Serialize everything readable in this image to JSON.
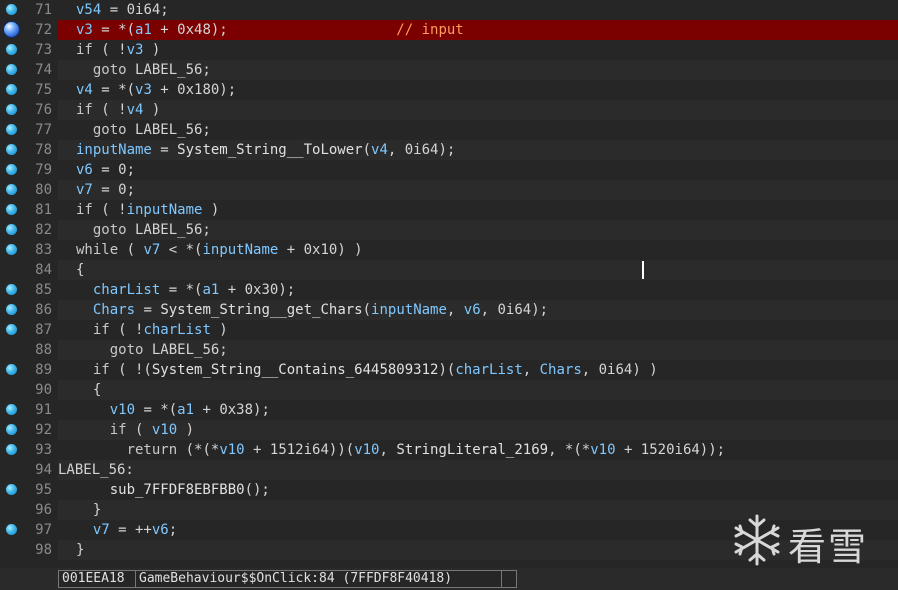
{
  "lines": [
    {
      "ln": "71",
      "bp": "dot",
      "tokens": [
        {
          "t": "v",
          "s": "v54"
        },
        {
          "t": "n",
          "s": " = 0i64;"
        }
      ]
    },
    {
      "ln": "72",
      "bp": "current",
      "hl": true,
      "tokens": [
        {
          "t": "v",
          "s": "v3"
        },
        {
          "t": "n",
          "s": " = *("
        },
        {
          "t": "v",
          "s": "a1"
        },
        {
          "t": "n",
          "s": " + 0x48);"
        },
        {
          "t": "c",
          "s": "                    // input"
        }
      ]
    },
    {
      "ln": "73",
      "bp": "dot",
      "tokens": [
        {
          "t": "k",
          "s": "if"
        },
        {
          "t": "n",
          "s": " ( !"
        },
        {
          "t": "v",
          "s": "v3"
        },
        {
          "t": "n",
          "s": " )"
        }
      ]
    },
    {
      "ln": "74",
      "bp": "dot",
      "tokens": [
        {
          "t": "n",
          "s": "  "
        },
        {
          "t": "k",
          "s": "goto"
        },
        {
          "t": "n",
          "s": " LABEL_56;"
        }
      ]
    },
    {
      "ln": "75",
      "bp": "dot",
      "tokens": [
        {
          "t": "v",
          "s": "v4"
        },
        {
          "t": "n",
          "s": " = *("
        },
        {
          "t": "v",
          "s": "v3"
        },
        {
          "t": "n",
          "s": " + 0x180);"
        }
      ]
    },
    {
      "ln": "76",
      "bp": "dot",
      "tokens": [
        {
          "t": "k",
          "s": "if"
        },
        {
          "t": "n",
          "s": " ( !"
        },
        {
          "t": "v",
          "s": "v4"
        },
        {
          "t": "n",
          "s": " )"
        }
      ]
    },
    {
      "ln": "77",
      "bp": "dot",
      "tokens": [
        {
          "t": "n",
          "s": "  "
        },
        {
          "t": "k",
          "s": "goto"
        },
        {
          "t": "n",
          "s": " LABEL_56;"
        }
      ]
    },
    {
      "ln": "78",
      "bp": "dot",
      "tokens": [
        {
          "t": "v",
          "s": "inputName"
        },
        {
          "t": "n",
          "s": " = "
        },
        {
          "t": "f",
          "s": "System_String__ToLower"
        },
        {
          "t": "n",
          "s": "("
        },
        {
          "t": "v",
          "s": "v4"
        },
        {
          "t": "n",
          "s": ", 0i64);"
        }
      ]
    },
    {
      "ln": "79",
      "bp": "dot",
      "tokens": [
        {
          "t": "v",
          "s": "v6"
        },
        {
          "t": "n",
          "s": " = 0;"
        }
      ]
    },
    {
      "ln": "80",
      "bp": "dot",
      "tokens": [
        {
          "t": "v",
          "s": "v7"
        },
        {
          "t": "n",
          "s": " = 0;"
        }
      ]
    },
    {
      "ln": "81",
      "bp": "dot",
      "tokens": [
        {
          "t": "k",
          "s": "if"
        },
        {
          "t": "n",
          "s": " ( !"
        },
        {
          "t": "v",
          "s": "inputName"
        },
        {
          "t": "n",
          "s": " )"
        }
      ]
    },
    {
      "ln": "82",
      "bp": "dot",
      "tokens": [
        {
          "t": "n",
          "s": "  "
        },
        {
          "t": "k",
          "s": "goto"
        },
        {
          "t": "n",
          "s": " LABEL_56;"
        }
      ]
    },
    {
      "ln": "83",
      "bp": "dot",
      "tokens": [
        {
          "t": "k",
          "s": "while"
        },
        {
          "t": "n",
          "s": " ( "
        },
        {
          "t": "v",
          "s": "v7"
        },
        {
          "t": "n",
          "s": " < *("
        },
        {
          "t": "v",
          "s": "inputName"
        },
        {
          "t": "n",
          "s": " + 0x10) )"
        }
      ]
    },
    {
      "ln": "84",
      "bp": "none",
      "tokens": [
        {
          "t": "n",
          "s": "{"
        }
      ]
    },
    {
      "ln": "85",
      "bp": "dot",
      "tokens": [
        {
          "t": "n",
          "s": "  "
        },
        {
          "t": "v",
          "s": "charList"
        },
        {
          "t": "n",
          "s": " = *("
        },
        {
          "t": "v",
          "s": "a1"
        },
        {
          "t": "n",
          "s": " + 0x30);"
        }
      ]
    },
    {
      "ln": "86",
      "bp": "dot",
      "tokens": [
        {
          "t": "n",
          "s": "  "
        },
        {
          "t": "v",
          "s": "Chars"
        },
        {
          "t": "n",
          "s": " = "
        },
        {
          "t": "f",
          "s": "System_String__get_Chars"
        },
        {
          "t": "n",
          "s": "("
        },
        {
          "t": "v",
          "s": "inputName"
        },
        {
          "t": "n",
          "s": ", "
        },
        {
          "t": "v",
          "s": "v6"
        },
        {
          "t": "n",
          "s": ", 0i64);"
        }
      ]
    },
    {
      "ln": "87",
      "bp": "dot",
      "tokens": [
        {
          "t": "n",
          "s": "  "
        },
        {
          "t": "k",
          "s": "if"
        },
        {
          "t": "n",
          "s": " ( !"
        },
        {
          "t": "v",
          "s": "charList"
        },
        {
          "t": "n",
          "s": " )"
        }
      ]
    },
    {
      "ln": "88",
      "bp": "none",
      "tokens": [
        {
          "t": "n",
          "s": "    "
        },
        {
          "t": "k",
          "s": "goto"
        },
        {
          "t": "n",
          "s": " LABEL_56;"
        }
      ]
    },
    {
      "ln": "89",
      "bp": "dot",
      "tokens": [
        {
          "t": "n",
          "s": "  "
        },
        {
          "t": "k",
          "s": "if"
        },
        {
          "t": "n",
          "s": " ( !("
        },
        {
          "t": "f",
          "s": "System_String__Contains_6445809312"
        },
        {
          "t": "n",
          "s": ")("
        },
        {
          "t": "v",
          "s": "charList"
        },
        {
          "t": "n",
          "s": ", "
        },
        {
          "t": "v",
          "s": "Chars"
        },
        {
          "t": "n",
          "s": ", 0i64) )"
        }
      ]
    },
    {
      "ln": "90",
      "bp": "none",
      "tokens": [
        {
          "t": "n",
          "s": "  {"
        }
      ]
    },
    {
      "ln": "91",
      "bp": "dot",
      "tokens": [
        {
          "t": "n",
          "s": "    "
        },
        {
          "t": "v",
          "s": "v10"
        },
        {
          "t": "n",
          "s": " = *("
        },
        {
          "t": "v",
          "s": "a1"
        },
        {
          "t": "n",
          "s": " + 0x38);"
        }
      ]
    },
    {
      "ln": "92",
      "bp": "dot",
      "tokens": [
        {
          "t": "n",
          "s": "    "
        },
        {
          "t": "k",
          "s": "if"
        },
        {
          "t": "n",
          "s": " ( "
        },
        {
          "t": "v",
          "s": "v10"
        },
        {
          "t": "n",
          "s": " )"
        }
      ]
    },
    {
      "ln": "93",
      "bp": "dot",
      "tokens": [
        {
          "t": "n",
          "s": "      "
        },
        {
          "t": "k",
          "s": "return"
        },
        {
          "t": "n",
          "s": " (*(*"
        },
        {
          "t": "v",
          "s": "v10"
        },
        {
          "t": "n",
          "s": " + 1512i64))("
        },
        {
          "t": "v",
          "s": "v10"
        },
        {
          "t": "n",
          "s": ", "
        },
        {
          "t": "f",
          "s": "StringLiteral_2169"
        },
        {
          "t": "n",
          "s": ", *(*"
        },
        {
          "t": "v",
          "s": "v10"
        },
        {
          "t": "n",
          "s": " + 1520i64));"
        }
      ]
    },
    {
      "ln": "94",
      "bp": "none",
      "label": true,
      "tokens": [
        {
          "t": "n",
          "s": "LABEL_56:"
        }
      ]
    },
    {
      "ln": "95",
      "bp": "dot",
      "tokens": [
        {
          "t": "n",
          "s": "    "
        },
        {
          "t": "f",
          "s": "sub_7FFDF8EBFBB0"
        },
        {
          "t": "n",
          "s": "();"
        }
      ]
    },
    {
      "ln": "96",
      "bp": "none",
      "tokens": [
        {
          "t": "n",
          "s": "  }"
        }
      ]
    },
    {
      "ln": "97",
      "bp": "dot",
      "tokens": [
        {
          "t": "n",
          "s": "  "
        },
        {
          "t": "v",
          "s": "v7"
        },
        {
          "t": "n",
          "s": " = ++"
        },
        {
          "t": "v",
          "s": "v6"
        },
        {
          "t": "n",
          "s": ";"
        }
      ]
    },
    {
      "ln": "98",
      "bp": "none",
      "tokens": [
        {
          "t": "n",
          "s": "}"
        }
      ]
    }
  ],
  "statusbar": {
    "address": "001EEA18",
    "location": "GameBehaviour$$OnClick:84 (7FFDF8F40418)",
    "extra": ""
  },
  "watermark": {
    "text": "看雪",
    "icon": "snowflake-icon"
  },
  "colors": {
    "highlight": "#7b0000",
    "variable": "#7fc8ff",
    "comment": "#ff9b63",
    "background": "#262626"
  }
}
